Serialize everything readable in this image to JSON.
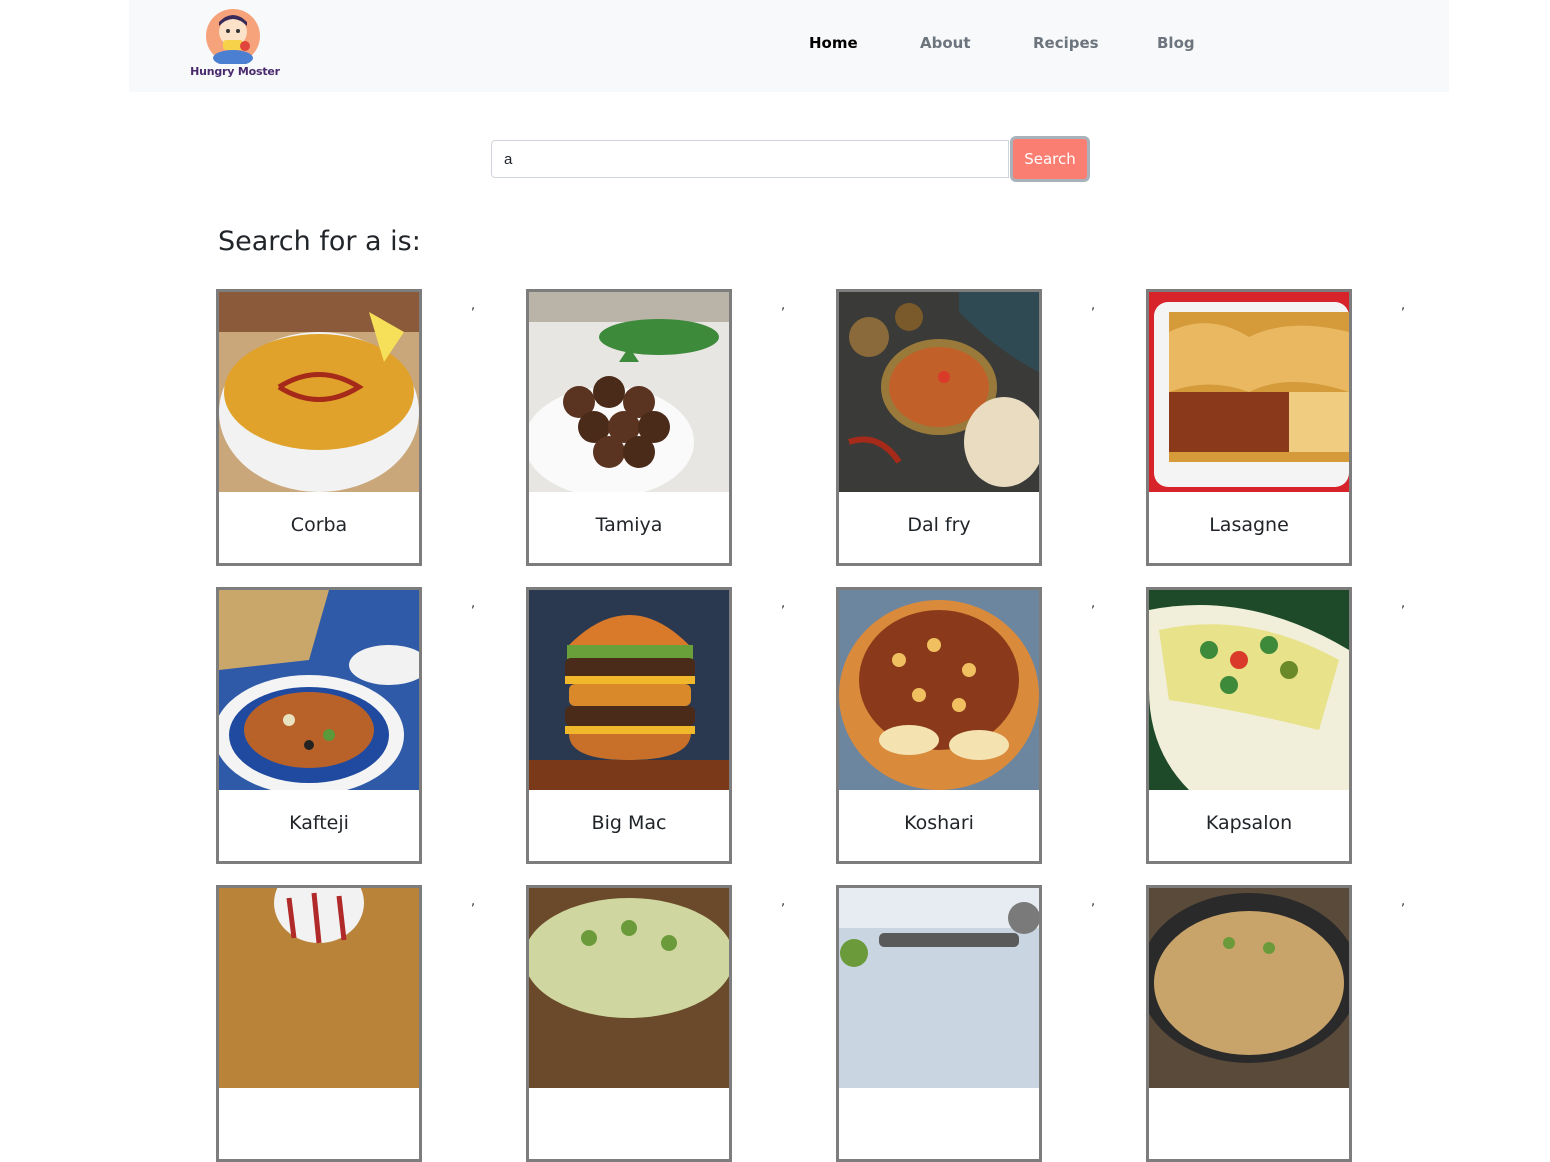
{
  "navbar": {
    "brand_name": "Hungry Moster",
    "links": [
      {
        "label": "Home",
        "active": true
      },
      {
        "label": "About",
        "active": false
      },
      {
        "label": "Recipes",
        "active": false
      },
      {
        "label": "Blog",
        "active": false
      }
    ]
  },
  "search": {
    "value": "a",
    "button_label": "Search"
  },
  "results": {
    "heading": "Search for a is:",
    "separator": ",",
    "items": [
      {
        "name": "Corba"
      },
      {
        "name": "Tamiya"
      },
      {
        "name": "Dal fry"
      },
      {
        "name": "Lasagne"
      },
      {
        "name": "Kafteji"
      },
      {
        "name": "Big Mac"
      },
      {
        "name": "Koshari"
      },
      {
        "name": "Kapsalon"
      },
      {
        "name": ""
      },
      {
        "name": ""
      },
      {
        "name": ""
      },
      {
        "name": ""
      }
    ]
  },
  "colors": {
    "search_button": "#fa7e71",
    "navbar_bg": "#f8f9fa",
    "card_border": "#7d7d7d"
  }
}
